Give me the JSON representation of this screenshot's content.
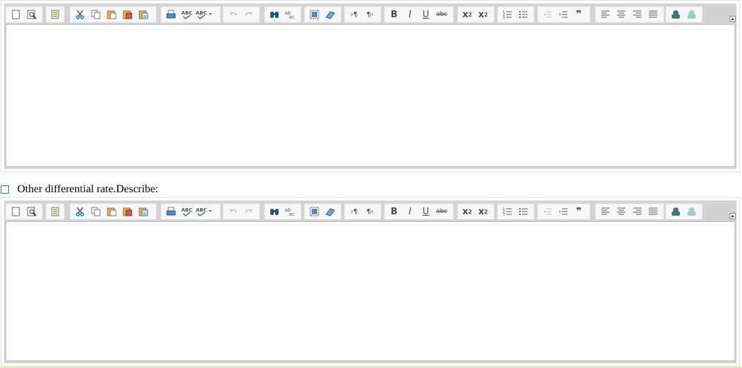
{
  "editors": [
    {
      "name": "editor-1"
    },
    {
      "name": "editor-2"
    }
  ],
  "checkbox": {
    "label": "Other differential rate.Describe:",
    "checked": false
  },
  "toolbar": {
    "groups": [
      {
        "name": "document",
        "buttons": [
          "new-page-icon",
          "preview-icon"
        ]
      },
      {
        "name": "templates",
        "buttons": [
          "templates-icon"
        ]
      },
      {
        "name": "clipboard",
        "buttons": [
          "cut-icon",
          "copy-icon",
          "paste-icon",
          "paste-text-icon",
          "paste-word-icon"
        ]
      },
      {
        "name": "spellcheck",
        "buttons": [
          "print-icon",
          "spell-check-icon",
          "spell-check-as-you-type-icon"
        ]
      },
      {
        "name": "history",
        "buttons": [
          "undo-icon",
          "redo-icon"
        ]
      },
      {
        "name": "find",
        "buttons": [
          "find-icon",
          "replace-icon"
        ]
      },
      {
        "name": "select",
        "buttons": [
          "select-all-icon",
          "remove-format-icon"
        ]
      },
      {
        "name": "direction",
        "buttons": [
          "ltr-icon",
          "rtl-icon"
        ]
      },
      {
        "name": "basicstyles",
        "buttons": [
          "bold-icon",
          "italic-icon",
          "underline-icon",
          "strike-icon"
        ]
      },
      {
        "name": "scripts",
        "buttons": [
          "subscript-icon",
          "superscript-icon"
        ]
      },
      {
        "name": "lists",
        "buttons": [
          "numbered-list-icon",
          "bulleted-list-icon"
        ]
      },
      {
        "name": "indent",
        "buttons": [
          "outdent-icon",
          "indent-icon",
          "blockquote-icon"
        ]
      },
      {
        "name": "align",
        "buttons": [
          "align-left-icon",
          "align-center-icon",
          "align-right-icon",
          "justify-icon"
        ]
      },
      {
        "name": "links",
        "buttons": [
          "link-icon",
          "unlink-icon"
        ]
      }
    ]
  }
}
